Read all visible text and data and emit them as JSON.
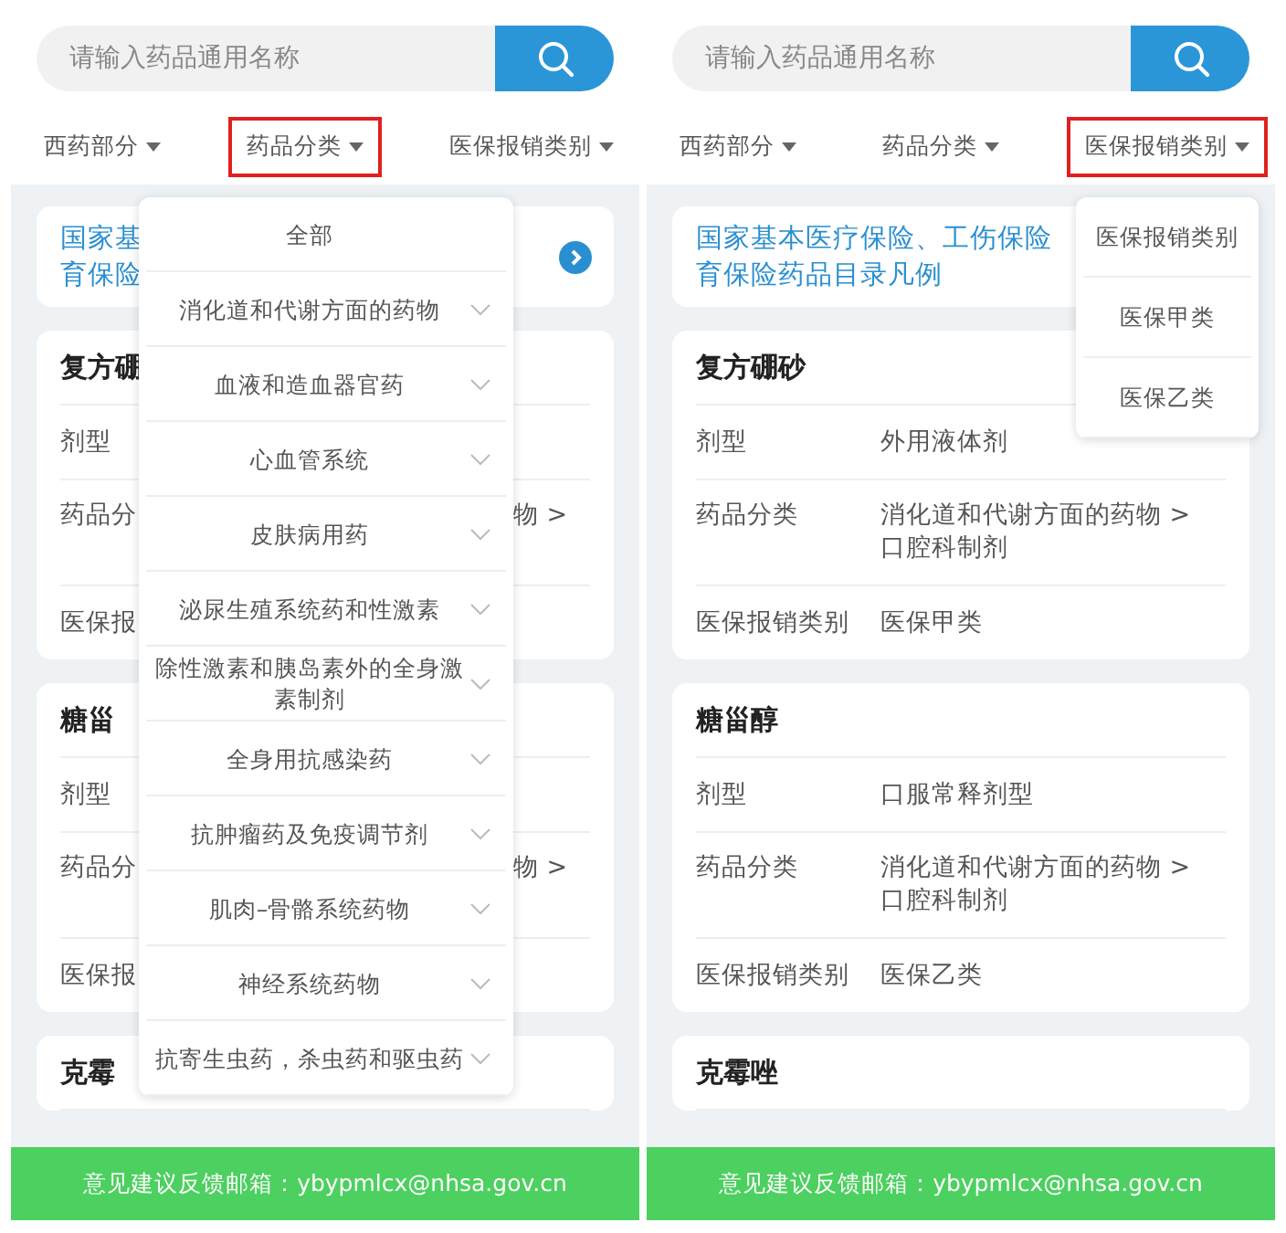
{
  "screens": [
    {
      "search": {
        "placeholder": "请输入药品通用名称"
      },
      "filters": [
        {
          "label": "西药部分",
          "highlighted": false
        },
        {
          "label": "药品分类",
          "highlighted": true
        },
        {
          "label": "医保报销类别",
          "highlighted": false
        }
      ],
      "notice": {
        "lines": [
          "国家基",
          "育保险"
        ],
        "arrow": true
      },
      "cards": [
        {
          "title": "复方硼",
          "rows": [
            {
              "label": "剂型",
              "kind": "single"
            },
            {
              "label": "药品分",
              "value": "物 >",
              "covered": true,
              "kind": "double"
            },
            {
              "label": "医保报",
              "kind": "single"
            }
          ]
        },
        {
          "title": "糖甾",
          "rows": [
            {
              "label": "剂型",
              "kind": "single"
            },
            {
              "label": "药品分",
              "value": "物 >",
              "covered": true,
              "kind": "double"
            },
            {
              "label": "医保报",
              "kind": "single"
            }
          ]
        },
        {
          "title": "克霉"
        }
      ],
      "menu": {
        "items": [
          {
            "label": "全部",
            "expandable": false
          },
          {
            "label": "消化道和代谢方面的药物",
            "expandable": true
          },
          {
            "label": "血液和造血器官药",
            "expandable": true
          },
          {
            "label": "心血管系统",
            "expandable": true
          },
          {
            "label": "皮肤病用药",
            "expandable": true
          },
          {
            "label": "泌尿生殖系统药和性激素",
            "expandable": true
          },
          {
            "label": "除性激素和胰岛素外的全身激素制剂",
            "expandable": true
          },
          {
            "label": "全身用抗感染药",
            "expandable": true
          },
          {
            "label": "抗肿瘤药及免疫调节剂",
            "expandable": true
          },
          {
            "label": "肌肉–骨骼系统药物",
            "expandable": true
          },
          {
            "label": "神经系统药物",
            "expandable": true
          },
          {
            "label": "抗寄生虫药，杀虫药和驱虫药",
            "expandable": true
          }
        ]
      },
      "footer": "意见建议反馈邮箱：ybypmlcx@nhsa.gov.cn"
    },
    {
      "search": {
        "placeholder": "请输入药品通用名称"
      },
      "filters": [
        {
          "label": "西药部分",
          "highlighted": false
        },
        {
          "label": "药品分类",
          "highlighted": false
        },
        {
          "label": "医保报销类别",
          "highlighted": true
        }
      ],
      "notice": {
        "lines": [
          "国家基本医疗保险、工伤保险",
          "育保险药品目录凡例"
        ],
        "arrow": false
      },
      "cards": [
        {
          "title": "复方硼砂",
          "rows": [
            {
              "label": "剂型",
              "value": "外用液体剂",
              "kind": "single"
            },
            {
              "label": "药品分类",
              "value": "消化道和代谢方面的药物 >\n口腔科制剂",
              "kind": "double"
            },
            {
              "label": "医保报销类别",
              "value": "医保甲类",
              "kind": "single"
            }
          ]
        },
        {
          "title": "糖甾醇",
          "rows": [
            {
              "label": "剂型",
              "value": "口服常释剂型",
              "kind": "single"
            },
            {
              "label": "药品分类",
              "value": "消化道和代谢方面的药物 >\n口腔科制剂",
              "kind": "double"
            },
            {
              "label": "医保报销类别",
              "value": "医保乙类",
              "kind": "single"
            }
          ]
        },
        {
          "title": "克霉唑"
        }
      ],
      "menu": {
        "items": [
          {
            "label": "医保报销类别",
            "expandable": false
          },
          {
            "label": "医保甲类",
            "expandable": false
          },
          {
            "label": "医保乙类",
            "expandable": false
          }
        ]
      },
      "footer": "意见建议反馈邮箱：ybypmlcx@nhsa.gov.cn"
    }
  ]
}
